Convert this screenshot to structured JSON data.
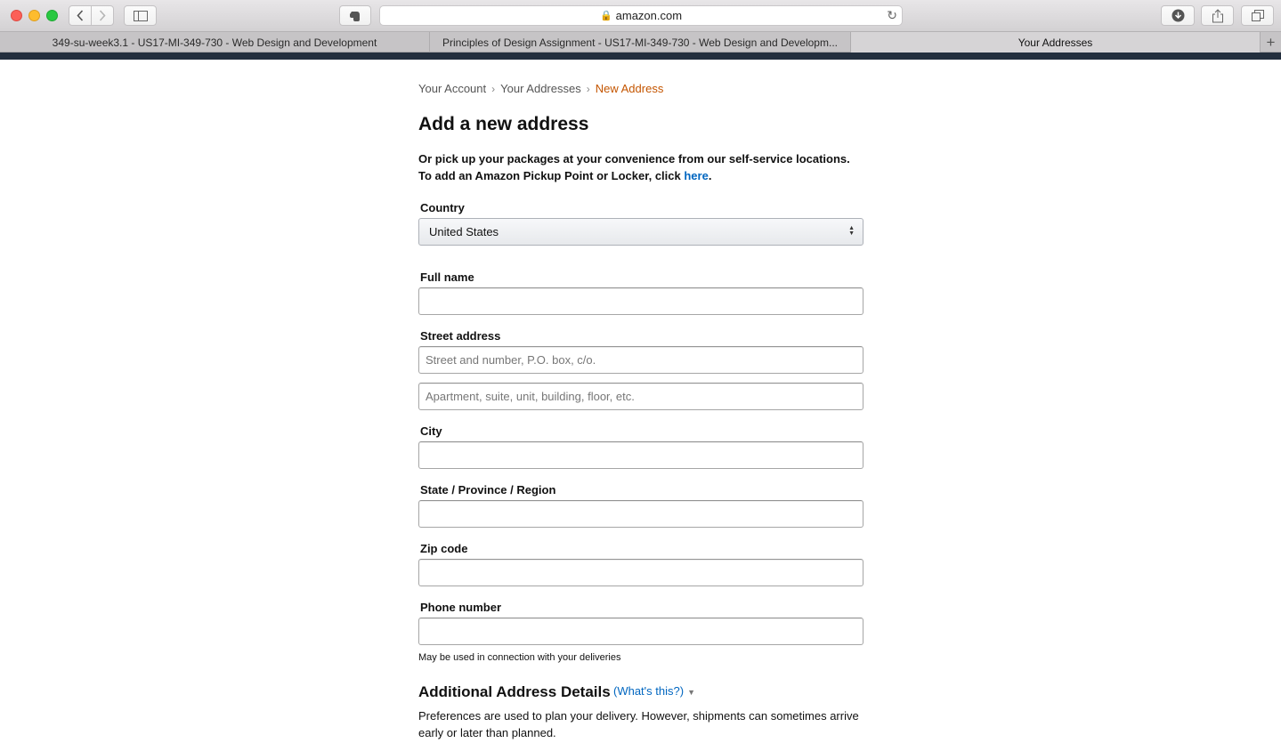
{
  "browser": {
    "url": "amazon.com",
    "tabs": [
      {
        "label": "349-su-week3.1 - US17-MI-349-730 - Web Design and Development"
      },
      {
        "label": "Principles of Design Assignment - US17-MI-349-730 - Web Design and Developm..."
      },
      {
        "label": "Your Addresses"
      }
    ]
  },
  "breadcrumb": {
    "items": [
      "Your Account",
      "Your Addresses"
    ],
    "current": "New Address",
    "separator": "›"
  },
  "page": {
    "title": "Add a new address",
    "intro_text": "Or pick up your packages at your convenience from our self-service locations. To add an Amazon Pickup Point or Locker, click ",
    "intro_link": "here",
    "intro_end": "."
  },
  "form": {
    "country_label": "Country",
    "country_value": "United States",
    "fullname_label": "Full name",
    "street_label": "Street address",
    "street_placeholder": "Street and number, P.O. box, c/o.",
    "street2_placeholder": "Apartment, suite, unit, building, floor, etc.",
    "city_label": "City",
    "state_label": "State / Province / Region",
    "zip_label": "Zip code",
    "phone_label": "Phone number",
    "phone_hint": "May be used in connection with your deliveries"
  },
  "additional": {
    "title": "Additional Address Details",
    "whats_this": "(What's this?)",
    "preferences_text": "Preferences are used to plan your delivery. However, shipments can sometimes arrive early or later than planned."
  },
  "colors": {
    "breadcrumb_current": "#c45500",
    "link": "#0066c0",
    "header_strip": "#232f3e"
  }
}
